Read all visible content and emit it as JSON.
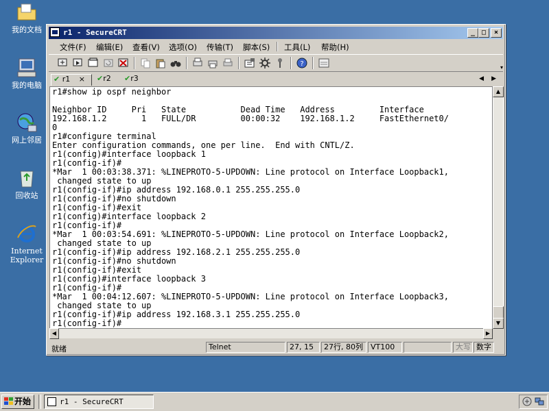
{
  "desktop": {
    "icons": [
      {
        "label": "我的文档",
        "icon": "folder-documents-icon"
      },
      {
        "label": "我的电脑",
        "icon": "computer-icon"
      },
      {
        "label": "网上邻居",
        "icon": "network-icon"
      },
      {
        "label": "回收站",
        "icon": "recycle-bin-icon"
      },
      {
        "label_line1": "Internet",
        "label_line2": "Explorer",
        "icon": "ie-icon"
      }
    ]
  },
  "window": {
    "title": "r1 - SecureCRT",
    "controls": {
      "minimize": "_",
      "maximize": "□",
      "close": "×"
    }
  },
  "menu": {
    "items": [
      "文件(F)",
      "编辑(E)",
      "查看(V)",
      "选项(O)",
      "传输(T)",
      "脚本(S)",
      "工具(L)",
      "帮助(H)"
    ]
  },
  "tabs": [
    {
      "label": "r1",
      "active": true,
      "close": "×"
    },
    {
      "label": "r2",
      "active": false
    },
    {
      "label": "r3",
      "active": false
    }
  ],
  "terminal": {
    "lines": [
      "r1#show ip ospf neighbor",
      "",
      "Neighbor ID     Pri   State           Dead Time   Address         Interface",
      "192.168.1.2       1   FULL/DR         00:00:32    192.168.1.2     FastEthernet0/",
      "0",
      "r1#configure terminal",
      "Enter configuration commands, one per line.  End with CNTL/Z.",
      "r1(config)#interface loopback 1",
      "r1(config-if)#",
      "*Mar  1 00:03:38.371: %LINEPROTO-5-UPDOWN: Line protocol on Interface Loopback1,",
      " changed state to up",
      "r1(config-if)#ip address 192.168.0.1 255.255.255.0",
      "r1(config-if)#no shutdown",
      "r1(config-if)#exit",
      "r1(config)#interface loopback 2",
      "r1(config-if)#",
      "*Mar  1 00:03:54.691: %LINEPROTO-5-UPDOWN: Line protocol on Interface Loopback2,",
      " changed state to up",
      "r1(config-if)#ip address 192.168.2.1 255.255.255.0",
      "r1(config-if)#no shutdown",
      "r1(config-if)#exit",
      "r1(config)#interface loopback 3",
      "r1(config-if)#",
      "*Mar  1 00:04:12.607: %LINEPROTO-5-UPDOWN: Line protocol on Interface Loopback3,",
      " changed state to up",
      "r1(config-if)#ip address 192.168.3.1 255.255.255.0",
      "r1(config-if)#"
    ]
  },
  "status": {
    "ready": "就绪",
    "protocol": "Telnet",
    "cursor": "27, 15",
    "size": "27行, 80列",
    "emulation": "VT100",
    "caps": "大写",
    "num": "数字"
  },
  "taskbar": {
    "start_label": "开始",
    "task_label": "r1 - SecureCRT"
  },
  "colors": {
    "desktop": "#3a6ea5",
    "title_start": "#0a246a",
    "title_end": "#a6caf0",
    "chrome": "#d4d0c8"
  }
}
